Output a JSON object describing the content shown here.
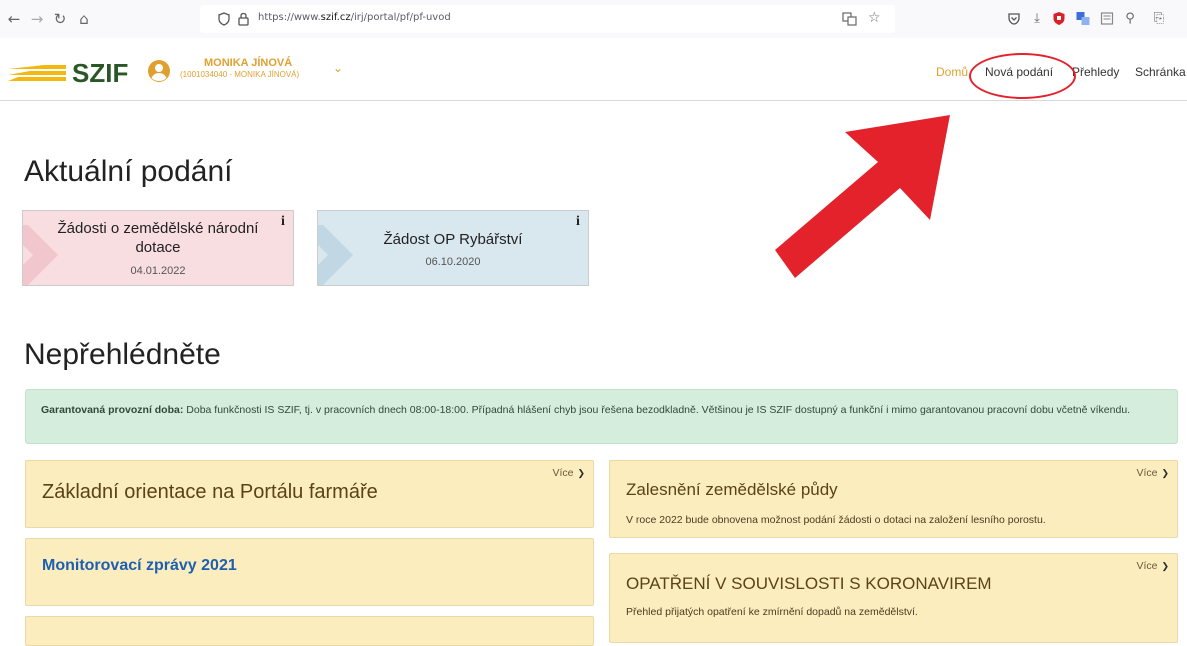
{
  "browser": {
    "url_prefix": "https://www.",
    "url_domain": "szif.cz",
    "url_path": "/irj/portal/pf/pf-uvod",
    "icons": [
      "back-icon",
      "forward-icon",
      "reload-icon",
      "home-icon",
      "shield-icon",
      "lock-icon",
      "translate-icon",
      "star-icon",
      "pocket-icon",
      "download-icon",
      "ublock-icon",
      "translator-icon",
      "reader-icon",
      "extensions-icon",
      "menu-icon"
    ]
  },
  "header": {
    "logo": "SZIF",
    "user_name": "MONIKA JÍNOVÁ",
    "user_id": "(1001034040 - MONIKA JÍNOVÁ)",
    "nav": [
      {
        "label": "Domů",
        "active": true
      },
      {
        "label": "Nová podání",
        "active": false
      },
      {
        "label": "Přehledy",
        "active": false
      },
      {
        "label": "Schránka",
        "active": false
      }
    ]
  },
  "current": {
    "heading": "Aktuální podání",
    "tiles": [
      {
        "title": "Žádosti o zemědělské národní dotace",
        "date": "04.01.2022",
        "info": "i",
        "color": "#f8dde1"
      },
      {
        "title": "Žádost OP Rybářství",
        "date": "06.10.2020",
        "info": "i",
        "color": "#d9e7ef"
      }
    ]
  },
  "notices": {
    "heading": "Nepřehlédněte",
    "alert_label": "Garantovaná provozní doba:",
    "alert_text": " Doba funkčnosti IS SZIF, tj. v pracovních dnech 08:00-18:00. Případná hlášení chyb jsou řešena bezodkladně. Většinou je IS SZIF dostupný a funkční i mimo garantovanou pracovní dobu včetně víkendu.",
    "more_label": "Více",
    "cards": [
      {
        "title": "Základní orientace na Portálu farmáře",
        "desc": ""
      },
      {
        "title": "Monitorovací zprávy 2021",
        "desc": ""
      },
      {
        "title": "Zalesnění zemědělské půdy",
        "desc": "V roce 2022 bude obnovena možnost podání žádosti o dotaci na založení lesního porostu."
      },
      {
        "title": "OPATŘENÍ V SOUVISLOSTI S KORONAVIREM",
        "desc": "Přehled přijatých opatření ke zmírnění dopadů na zemědělství."
      }
    ]
  },
  "colors": {
    "brand_green": "#2a5726",
    "accent_orange": "#e0a030",
    "annotation_red": "#e3222c",
    "alert_bg": "#d5eddc",
    "card_bg": "#fcedbf",
    "link_blue": "#1d5fb0"
  }
}
